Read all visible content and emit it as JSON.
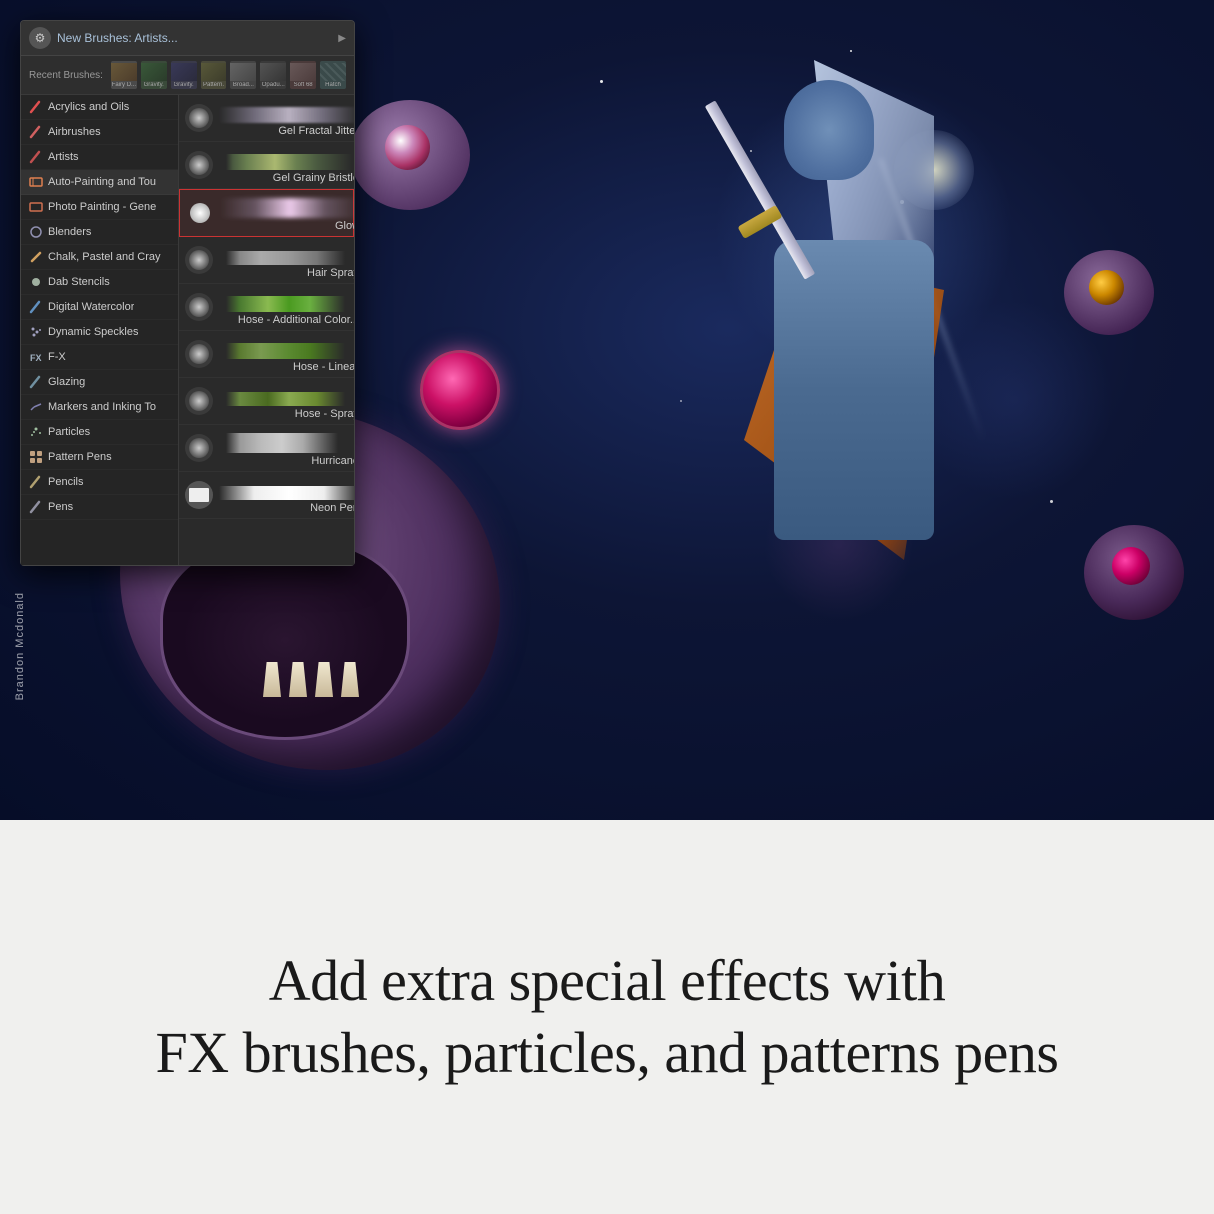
{
  "panel": {
    "header": {
      "title": "New Brushes: Artists...",
      "gear_icon": "⚙"
    },
    "recent": {
      "label": "Recent Brushes:",
      "items": [
        {
          "name": "Fairy D...",
          "bg": "#4a4a4a"
        },
        {
          "name": "Gravity.",
          "bg": "#3a4a3a"
        },
        {
          "name": "Gravity.",
          "bg": "#3a3a4a"
        },
        {
          "name": "Pattern.",
          "bg": "#4a4a3a"
        },
        {
          "name": "Broad...",
          "bg": "#444"
        },
        {
          "name": "Opadu...",
          "bg": "#3a3a3a"
        },
        {
          "name": "Soft 68",
          "bg": "#4a3a3a"
        },
        {
          "name": "Hatch",
          "bg": "#3a4a4a"
        }
      ]
    },
    "categories": [
      {
        "label": "Acrylics and Oils",
        "icon_color": "#e05050"
      },
      {
        "label": "Airbrushes",
        "icon_color": "#d06060"
      },
      {
        "label": "Artists",
        "icon_color": "#c05050"
      },
      {
        "label": "Auto-Painting and Tou",
        "icon_color": "#e08050"
      },
      {
        "label": "Photo Painting - Gene",
        "icon_color": "#d07050"
      },
      {
        "label": "Blenders",
        "icon_color": "#9090b0"
      },
      {
        "label": "Chalk, Pastel and Cray",
        "icon_color": "#d0a060"
      },
      {
        "label": "Dab Stencils",
        "icon_color": "#a0b0a0"
      },
      {
        "label": "Digital Watercolor",
        "icon_color": "#6090c0"
      },
      {
        "label": "Dynamic Speckles",
        "icon_color": "#a0a0c0"
      },
      {
        "label": "F-X",
        "icon_color": "#a0b0c0"
      },
      {
        "label": "Glazing",
        "icon_color": "#7090a0"
      },
      {
        "label": "Markers and Inking To",
        "icon_color": "#8080b0"
      },
      {
        "label": "Particles",
        "icon_color": "#a0c0a0"
      },
      {
        "label": "Pattern Pens",
        "icon_color": "#c0a080"
      },
      {
        "label": "Pencils",
        "icon_color": "#b0a070"
      },
      {
        "label": "Pens",
        "icon_color": "#9090a0"
      }
    ],
    "brushes": [
      {
        "name": "Gel Fractal Jitter",
        "preview": "dot",
        "stroke": "gel-fractal",
        "selected": false
      },
      {
        "name": "Gel Grainy Bristle",
        "preview": "dot",
        "stroke": "gel-grainy",
        "selected": false
      },
      {
        "name": "Glow",
        "preview": "white",
        "stroke": "glow",
        "selected": true
      },
      {
        "name": "Hair Spray",
        "preview": "dot",
        "stroke": "hair-spray",
        "selected": false
      },
      {
        "name": "Hose - Additional Color...",
        "preview": "dot",
        "stroke": "hose-color",
        "selected": false
      },
      {
        "name": "Hose - Linear",
        "preview": "dot",
        "stroke": "hose-linear",
        "selected": false
      },
      {
        "name": "Hose - Spray",
        "preview": "dot",
        "stroke": "hose-spray",
        "selected": false
      },
      {
        "name": "Hurricane",
        "preview": "dot",
        "stroke": "hurricane",
        "selected": false
      },
      {
        "name": "Neon Pen",
        "preview": "white",
        "stroke": "neon",
        "selected": false
      }
    ]
  },
  "watermark": "Brandon Mcdonald",
  "tagline": {
    "line1": "Add extra special effects with",
    "line2": "FX brushes, particles, and patterns pens"
  }
}
